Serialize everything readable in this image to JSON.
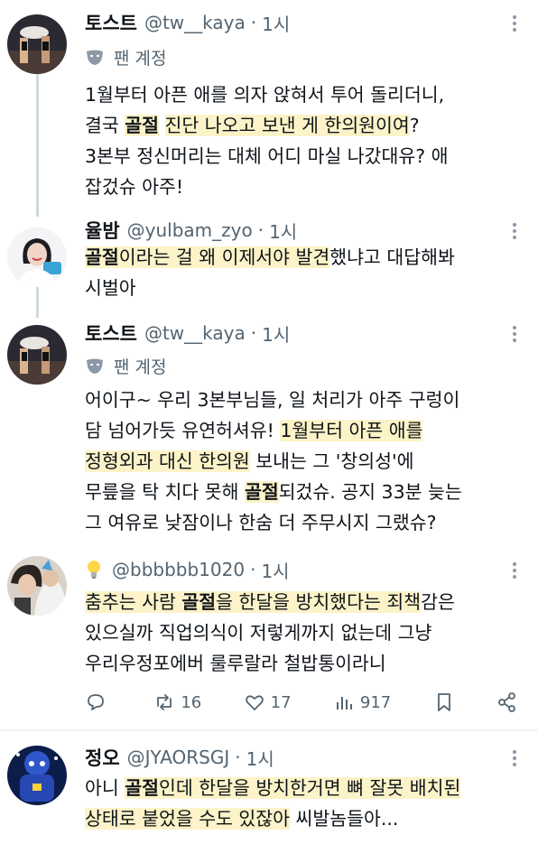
{
  "colors": {
    "highlight": "#fdf3c8",
    "secondary_text": "#536471",
    "separator": "#eff3f4"
  },
  "posts": [
    {
      "name": "토스트",
      "handle": "@tw__kaya",
      "sep": "·",
      "time": "1시",
      "badge": "팬 계정",
      "lines": [
        [
          {
            "t": "1월부터 아픈 애를 의자 앉혀서 투어 돌리더니,"
          }
        ],
        [
          {
            "t": "결국 "
          },
          {
            "t": "골절",
            "s": "hb"
          },
          {
            "t": " "
          },
          {
            "t": "진단 나오고 보낸 게 한의원이여",
            "s": "hl"
          },
          {
            "t": "?"
          }
        ],
        [
          {
            "t": "3본부 정신머리는 대체 어디 마실 나갔대유? 애"
          }
        ],
        [
          {
            "t": "잡겄슈 아주!"
          }
        ]
      ]
    },
    {
      "name": "율밤",
      "handle": "@yulbam_zyo",
      "sep": "·",
      "time": "1시",
      "lines": [
        [
          {
            "t": "골절",
            "s": "hb"
          },
          {
            "t": "이라는 걸 왜 이제서야 발견",
            "s": "hl"
          },
          {
            "t": "했냐고 대답해봐"
          }
        ],
        [
          {
            "t": "시벌아"
          }
        ]
      ]
    },
    {
      "name": "토스트",
      "handle": "@tw__kaya",
      "sep": "·",
      "time": "1시",
      "badge": "팬 계정",
      "lines": [
        [
          {
            "t": "어이구~ 우리 3본부님들, 일 처리가 아주 구렁이"
          }
        ],
        [
          {
            "t": "담 넘어가듯 유연허셔유! "
          },
          {
            "t": "1월부터 아픈 애를",
            "s": "hl"
          }
        ],
        [
          {
            "t": "정형외과 대신 한의원",
            "s": "hl"
          },
          {
            "t": " 보내는 그 '창의성'에"
          }
        ],
        [
          {
            "t": "무릎을 탁 치다 못해 "
          },
          {
            "t": "골절",
            "s": "hb"
          },
          {
            "t": "되겄슈. 공지 33분 늦는"
          }
        ],
        [
          {
            "t": "그 여유로 낮잠이나 한숨 더 주무시지 그랬슈?"
          }
        ]
      ]
    },
    {
      "name": "",
      "handle": "@bbbbbb1020",
      "sep": "·",
      "time": "1시",
      "lines": [
        [
          {
            "t": "춤추는 사람 ",
            "s": "hl"
          },
          {
            "t": "골절",
            "s": "hb"
          },
          {
            "t": "을 한달을 방치했다는 죄책",
            "s": "hl"
          },
          {
            "t": "감은"
          }
        ],
        [
          {
            "t": "있으실까 직업의식이 저렇게까지 없는데 그냥"
          }
        ],
        [
          {
            "t": "우리우정포에버 룰루랄라 철밥통이라니"
          }
        ]
      ],
      "actions": {
        "reply": "",
        "retweets": "16",
        "likes": "17",
        "views": "917"
      }
    },
    {
      "name": "정오",
      "handle": "@JYAORSGJ",
      "sep": "·",
      "time": "1시",
      "lines": [
        [
          {
            "t": "아니 "
          },
          {
            "t": "골절",
            "s": "hb"
          },
          {
            "t": "인데 한달을 방치한거면 뼈 잘못 배치된",
            "s": "hl"
          }
        ],
        [
          {
            "t": "상태로 붙었을 수도 있잖아",
            "s": "hl"
          },
          {
            "t": " 씨발놈들아..."
          }
        ]
      ]
    }
  ]
}
